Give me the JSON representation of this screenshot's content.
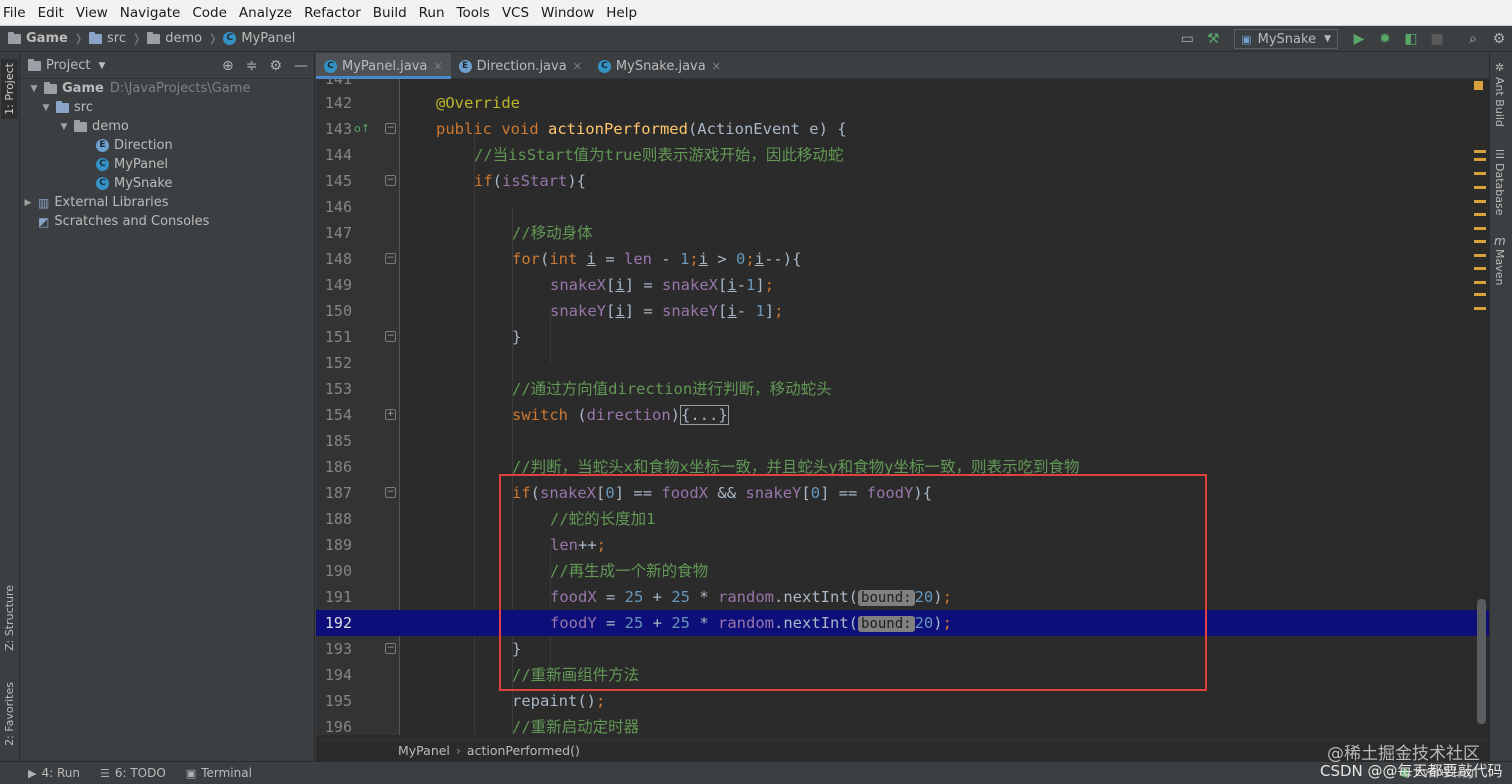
{
  "menu": [
    "File",
    "Edit",
    "View",
    "Navigate",
    "Code",
    "Analyze",
    "Refactor",
    "Build",
    "Run",
    "Tools",
    "VCS",
    "Window",
    "Help"
  ],
  "breadcrumb": [
    "Game",
    "src",
    "demo",
    "MyPanel"
  ],
  "run_config": "MySnake",
  "left_tabs": [
    "1: Project",
    "Z: Structure",
    "2: Favorites"
  ],
  "right_tabs": [
    "Ant Build",
    "Database",
    "Maven"
  ],
  "project_panel": {
    "title": "Project",
    "tree": [
      {
        "label": "Game",
        "path": "D:\\JavaProjects\\Game"
      },
      {
        "label": "src"
      },
      {
        "label": "demo"
      },
      {
        "label": "Direction"
      },
      {
        "label": "MyPanel"
      },
      {
        "label": "MySnake"
      },
      {
        "label": "External Libraries"
      },
      {
        "label": "Scratches and Consoles"
      }
    ]
  },
  "tabs": [
    {
      "label": "MyPanel.java",
      "active": true
    },
    {
      "label": "Direction.java",
      "active": false
    },
    {
      "label": "MySnake.java",
      "active": false
    }
  ],
  "code": {
    "current_line": 192,
    "top_partial_line": "141",
    "lines": [
      {
        "n": "142",
        "text": "@Override"
      },
      {
        "n": "143",
        "text": "public void actionPerformed(ActionEvent e) {"
      },
      {
        "n": "144",
        "text": "//当isStart值为true则表示游戏开始，因此移动蛇"
      },
      {
        "n": "145",
        "text": "if(isStart){"
      },
      {
        "n": "146",
        "text": ""
      },
      {
        "n": "147",
        "text": "//移动身体"
      },
      {
        "n": "148",
        "text": "for(int i = len - 1;i > 0;i--){"
      },
      {
        "n": "149",
        "text": "snakeX[i] = snakeX[i-1];"
      },
      {
        "n": "150",
        "text": "snakeY[i] = snakeY[i- 1];"
      },
      {
        "n": "151",
        "text": "}"
      },
      {
        "n": "152",
        "text": ""
      },
      {
        "n": "153",
        "text": "//通过方向值direction进行判断，移动蛇头"
      },
      {
        "n": "154",
        "text": "switch (direction){...}"
      },
      {
        "n": "185",
        "text": ""
      },
      {
        "n": "186",
        "text": "//判断，当蛇头x和食物x坐标一致，并且蛇头y和食物y坐标一致，则表示吃到食物"
      },
      {
        "n": "187",
        "text": "if(snakeX[0] == foodX && snakeY[0] == foodY){"
      },
      {
        "n": "188",
        "text": "//蛇的长度加1"
      },
      {
        "n": "189",
        "text": "len++;"
      },
      {
        "n": "190",
        "text": "//再生成一个新的食物"
      },
      {
        "n": "191",
        "text": "foodX = 25 + 25 * random.nextInt( bound: 20);"
      },
      {
        "n": "192",
        "text": "foodY = 25 + 25 * random.nextInt( bound: 20);"
      },
      {
        "n": "193",
        "text": "}"
      },
      {
        "n": "194",
        "text": "//重新画组件方法"
      },
      {
        "n": "195",
        "text": "repaint();"
      },
      {
        "n": "196",
        "text": "//重新启动定时器"
      }
    ]
  },
  "editor_breadcrumb": [
    "MyPanel",
    "actionPerformed()"
  ],
  "statusbar": {
    "run": "4: Run",
    "todo": "6: TODO",
    "terminal": "Terminal",
    "event_log": "Event Log"
  },
  "watermark": {
    "line1": "@稀土掘金技术社区",
    "line2": "CSDN @@每天都要敲代码"
  },
  "colors": {
    "editor_bg": "#2b2b2b",
    "current_line_bg": "#0e0e7a",
    "keyword": "#cc7832",
    "comment": "#629755",
    "number": "#6897bb",
    "field": "#9876aa",
    "annotation_box": "#e04040"
  }
}
